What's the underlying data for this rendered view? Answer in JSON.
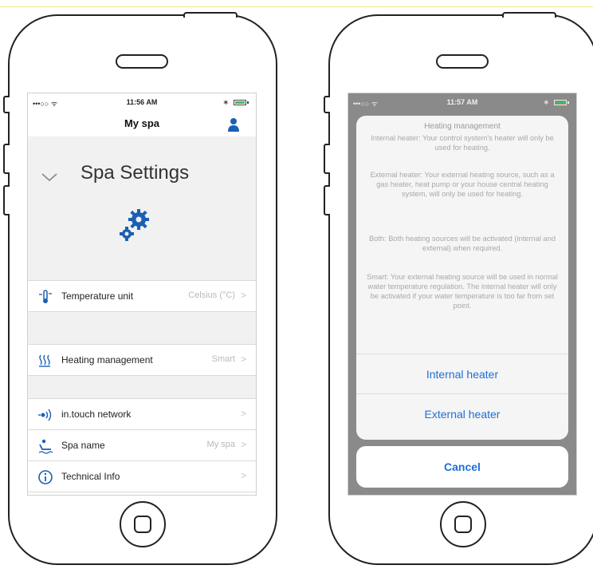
{
  "accent_color": "#1f6fd6",
  "left_phone": {
    "status": {
      "signal": "•••○○ ᯤ",
      "time": "11:56 AM",
      "bluetooth": "∗"
    },
    "nav_title": "My spa",
    "section_title": "Spa Settings",
    "rows": [
      {
        "icon": "thermometer-icon",
        "label": "Temperature unit",
        "value": "Celsius (°C)",
        "chevron": ">"
      },
      {
        "icon": "heating-icon",
        "label": "Heating management",
        "value": "Smart",
        "chevron": ">"
      },
      {
        "icon": "network-icon",
        "label": "in.touch network",
        "value": "",
        "chevron": ">"
      },
      {
        "icon": "spa-icon",
        "label": "Spa name",
        "value": "My spa",
        "chevron": ">"
      },
      {
        "icon": "info-icon",
        "label": "Technical Info",
        "value": "",
        "chevron": ">"
      }
    ]
  },
  "right_phone": {
    "status": {
      "signal": "•••○○ ᯤ",
      "time": "11:57 AM",
      "bluetooth": "∗"
    },
    "sheet_title": "Heating management",
    "paragraphs": [
      "Internal heater: Your control system's heater will only be used for heating.",
      "External heater: Your external heating source, such as a gas heater, heat pump or your house central heating system, will only be used for heating.",
      "Both: Both heating sources will be activated (internal and external) when required.",
      "Smart: Your external heating source will be used in normal water temperature regulation. The internal heater will only be activated if your water temperature is too far from set point."
    ],
    "buttons": [
      "Internal heater",
      "External heater"
    ],
    "cancel": "Cancel"
  }
}
